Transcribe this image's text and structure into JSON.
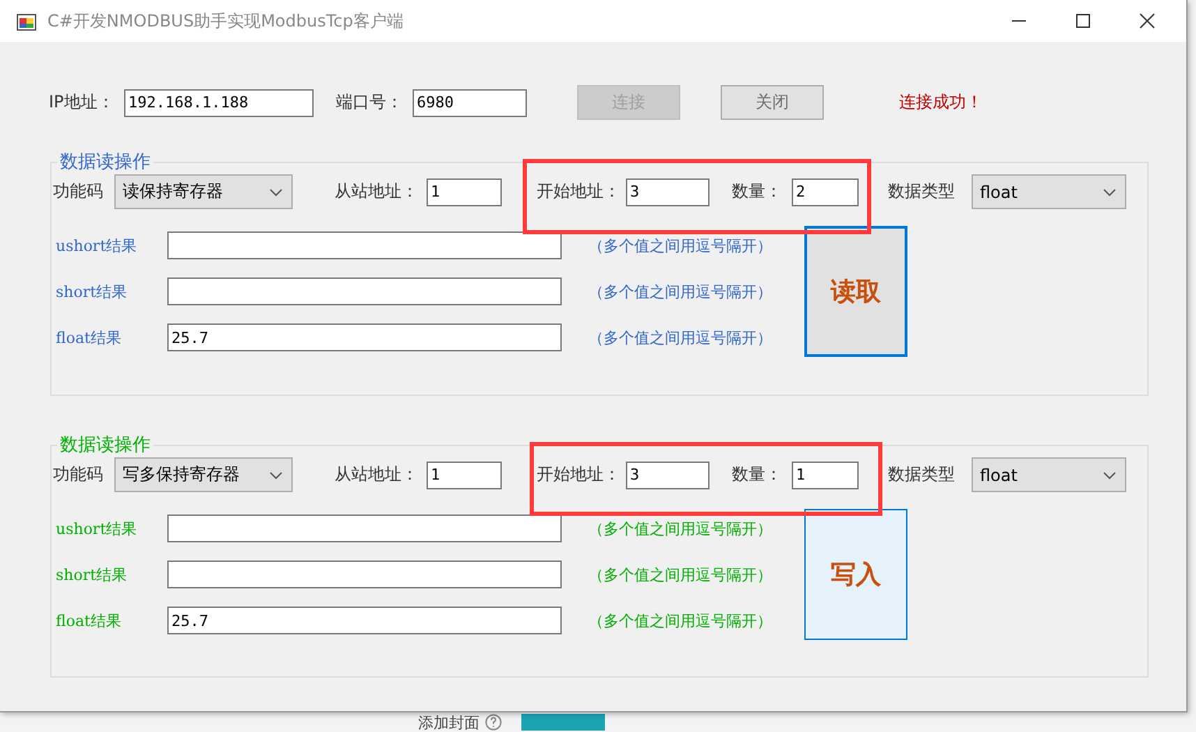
{
  "window": {
    "title": "C#开发NMODBUS助手实现ModbusTcp客户端"
  },
  "connection": {
    "ip_label": "IP地址：",
    "ip": "192.168.1.188",
    "port_label": "端口号：",
    "port": "6980",
    "buttons": [
      {
        "label": "连接",
        "disabled": true
      },
      {
        "label": "关闭",
        "disabled": false
      }
    ],
    "status": "连接成功！"
  },
  "groups": [
    {
      "legend": "数据读操作",
      "color": "#3366cc",
      "highlight": true,
      "function_label": "功能码",
      "function": "读保持寄存器",
      "slave_label": "从站地址：",
      "slave": "1",
      "start_label": "开始地址：",
      "start": "3",
      "count_label": "数量：",
      "count": "2",
      "type_label": "数据类型",
      "type": "float",
      "results": [
        {
          "label": "ushort结果",
          "hint": "（多个值之间用逗号隔开）"
        },
        {
          "label": "short结果",
          "hint": "（多个值之间用逗号隔开）"
        },
        {
          "label": "float结果",
          "value": "25.7",
          "hint": "（多个值之间用逗号隔开）"
        }
      ],
      "button": {
        "label": "读取",
        "focused": true,
        "hovered": false
      }
    },
    {
      "legend": "数据读操作",
      "color": "#00b000",
      "highlight": true,
      "function_label": "功能码",
      "function": "写多保持寄存器",
      "slave_label": "从站地址：",
      "slave": "1",
      "start_label": "开始地址：",
      "start": "3",
      "count_label": "数量：",
      "count": "1",
      "type_label": "数据类型",
      "type": "float",
      "results": [
        {
          "label": "ushort结果",
          "hint": "（多个值之间用逗号隔开）"
        },
        {
          "label": "short结果",
          "hint": "（多个值之间用逗号隔开）"
        },
        {
          "label": "float结果",
          "value": "25.7",
          "hint": "（多个值之间用逗号隔开）"
        }
      ],
      "button": {
        "label": "写入",
        "focused": false,
        "hovered": true
      }
    }
  ],
  "background": {
    "text": "添加封面"
  }
}
